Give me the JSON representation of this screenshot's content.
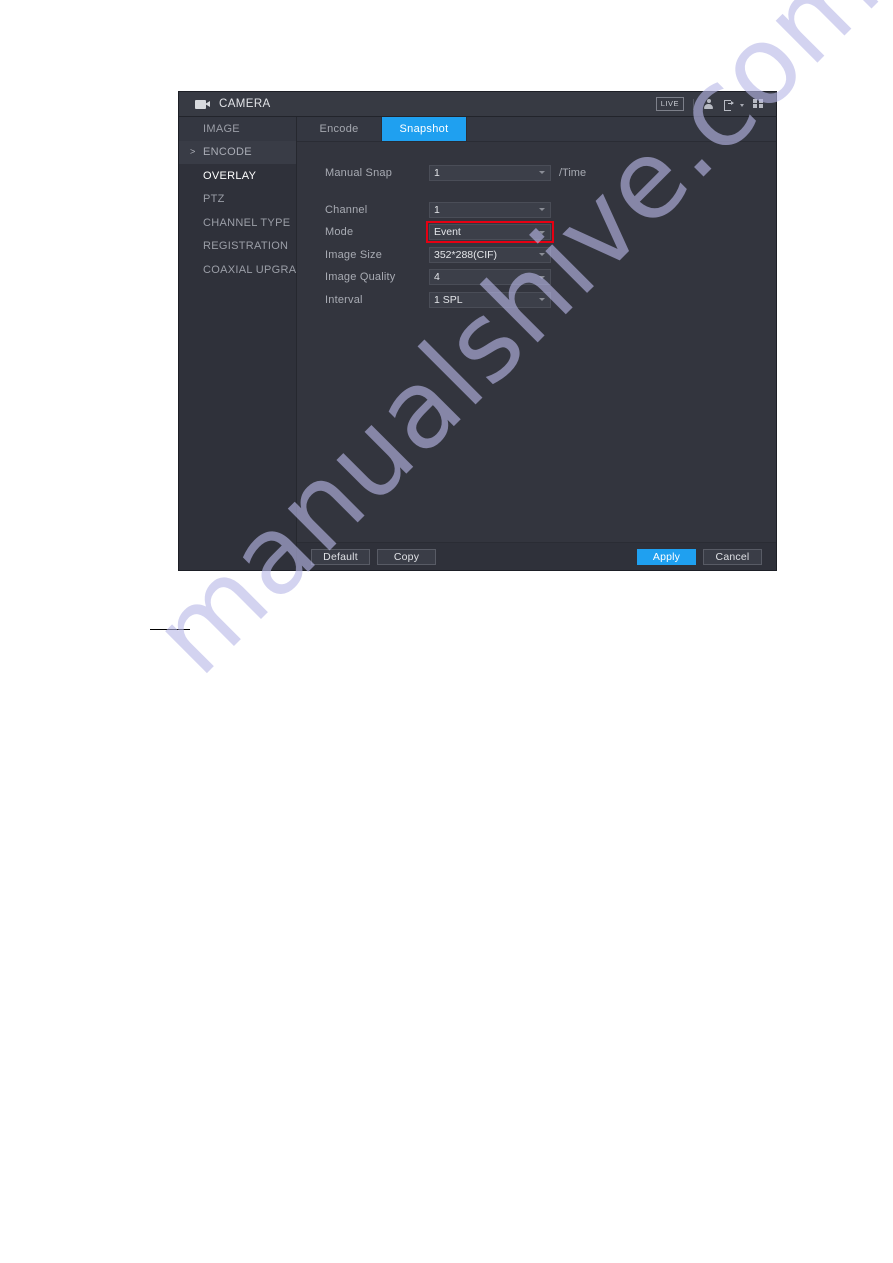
{
  "window": {
    "title": "CAMERA",
    "camera_icon": "video-camera-icon",
    "status_badge": "LIVE",
    "icons": {
      "user": "person-icon",
      "logout": "logout-icon",
      "grid": "grid-icon"
    }
  },
  "sidebar": {
    "items": [
      {
        "label": "IMAGE",
        "state": "normal"
      },
      {
        "label": "ENCODE",
        "state": "expanded",
        "marker": ">"
      },
      {
        "label": "OVERLAY",
        "state": "active"
      },
      {
        "label": "PTZ",
        "state": "normal"
      },
      {
        "label": "CHANNEL TYPE",
        "state": "normal"
      },
      {
        "label": "REGISTRATION",
        "state": "normal"
      },
      {
        "label": "COAXIAL UPGRADE",
        "state": "normal"
      }
    ]
  },
  "tabs": [
    {
      "label": "Encode",
      "active": false
    },
    {
      "label": "Snapshot",
      "active": true
    }
  ],
  "form": {
    "manual_snap": {
      "label": "Manual Snap",
      "value": "1",
      "unit": "/Time"
    },
    "channel": {
      "label": "Channel",
      "value": "1"
    },
    "mode": {
      "label": "Mode",
      "value": "Event",
      "highlighted": true
    },
    "image_size": {
      "label": "Image Size",
      "value": "352*288(CIF)"
    },
    "image_quality": {
      "label": "Image Quality",
      "value": "4"
    },
    "interval": {
      "label": "Interval",
      "value": "1 SPL"
    }
  },
  "footer": {
    "default_label": "Default",
    "copy_label": "Copy",
    "apply_label": "Apply",
    "cancel_label": "Cancel"
  },
  "watermark": {
    "text": "manualshive.com"
  },
  "colors": {
    "accent": "#1fa0f0",
    "highlight": "#e60012",
    "window_bg": "#2b2d35",
    "sidebar_bg": "#2f313a"
  }
}
